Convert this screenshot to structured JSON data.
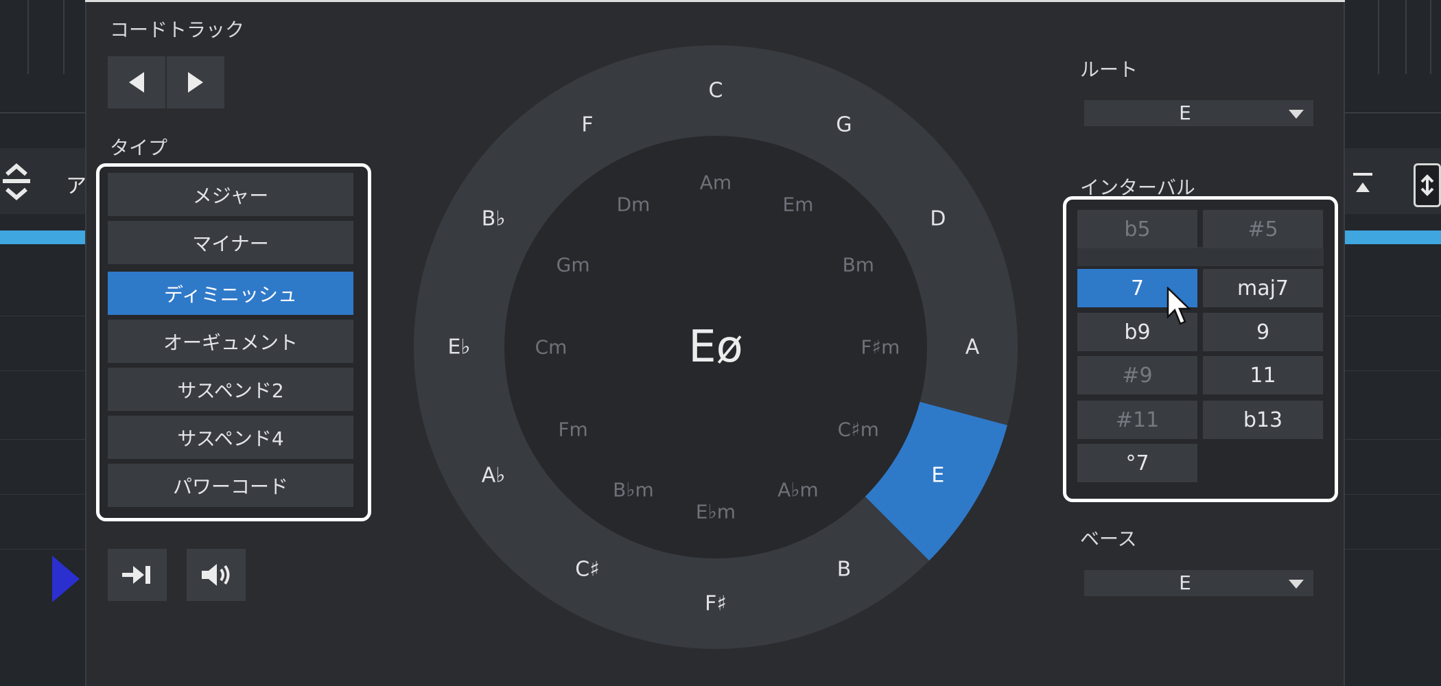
{
  "panel": {
    "chord_track_label": "コードトラック",
    "type_label": "タイプ",
    "root_label": "ルート",
    "interval_label": "インターバル",
    "bass_label": "ベース"
  },
  "background": {
    "toolbar_fragment": "ア"
  },
  "nav": {
    "prev_icon": "triangle-left",
    "next_icon": "triangle-right"
  },
  "types": [
    {
      "label": "メジャー",
      "selected": false
    },
    {
      "label": "マイナー",
      "selected": false
    },
    {
      "label": "ディミニッシュ",
      "selected": true
    },
    {
      "label": "オーギュメント",
      "selected": false
    },
    {
      "label": "サスペンド2",
      "selected": false
    },
    {
      "label": "サスペンド4",
      "selected": false
    },
    {
      "label": "パワーコード",
      "selected": false
    }
  ],
  "bottom_buttons": {
    "skip_icon": "skip-forward-icon",
    "audition_icon": "speaker-icon"
  },
  "wheel": {
    "center_chord": "Eø",
    "selected_outer": "E",
    "outer": [
      "C",
      "G",
      "D",
      "A",
      "E",
      "B",
      "F♯",
      "C♯",
      "A♭",
      "E♭",
      "B♭",
      "F"
    ],
    "inner": [
      "Am",
      "Em",
      "Bm",
      "F♯m",
      "C♯m",
      "A♭m",
      "E♭m",
      "B♭m",
      "Fm",
      "Cm",
      "Gm",
      "Dm"
    ]
  },
  "root": {
    "value": "E"
  },
  "bass": {
    "value": "E"
  },
  "intervals": [
    [
      {
        "label": "b5",
        "state": "dim"
      },
      {
        "label": "#5",
        "state": "dim"
      }
    ],
    [
      {
        "label": "7",
        "state": "selected"
      },
      {
        "label": "maj7",
        "state": "normal"
      }
    ],
    [
      {
        "label": "b9",
        "state": "normal"
      },
      {
        "label": "9",
        "state": "normal"
      }
    ],
    [
      {
        "label": "#9",
        "state": "dim"
      },
      {
        "label": "11",
        "state": "normal"
      }
    ],
    [
      {
        "label": "#11",
        "state": "dim"
      },
      {
        "label": "b13",
        "state": "normal"
      }
    ],
    [
      {
        "label": "°7",
        "state": "normal"
      },
      {
        "label": "",
        "state": "empty"
      }
    ]
  ],
  "colors": {
    "accent": "#2f79c9",
    "panel_bg": "#2a2c30",
    "ring_bg": "#383b40",
    "inner_bg": "#26282c",
    "highlight_frame": "#ffffff"
  }
}
